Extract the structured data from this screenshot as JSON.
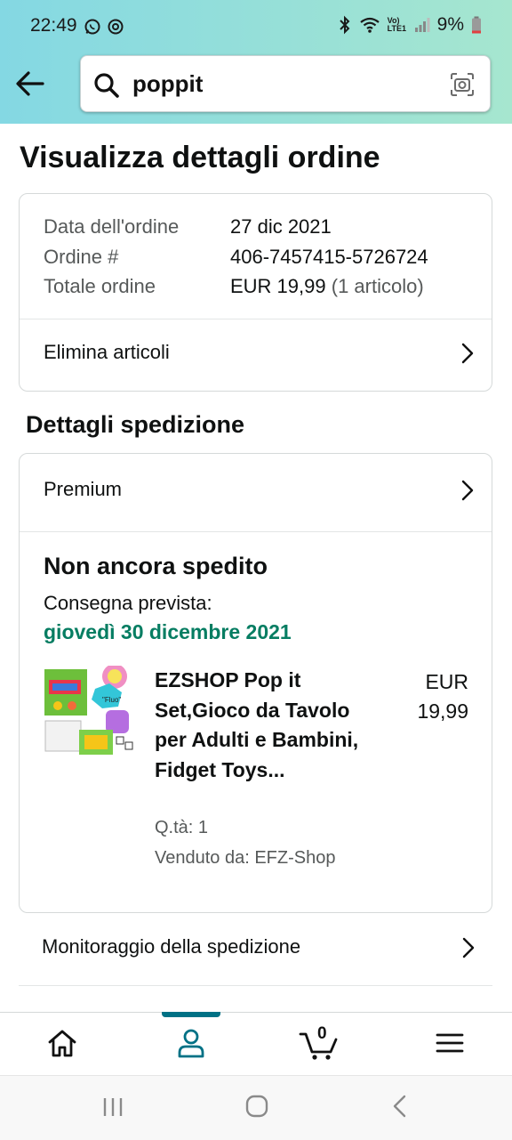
{
  "status_bar": {
    "time": "22:49",
    "battery": "9%",
    "network": "Vo) LTE1"
  },
  "search": {
    "query": "poppit"
  },
  "page_title": "Visualizza dettagli ordine",
  "order_summary": {
    "date_label": "Data dell'ordine",
    "date_value": "27 dic 2021",
    "number_label": "Ordine #",
    "number_value": "406-7457415-5726724",
    "total_label": "Totale ordine",
    "total_value": "EUR 19,99",
    "total_items": "(1 articolo)",
    "remove_items_label": "Elimina articoli"
  },
  "shipping_section_title": "Dettagli spedizione",
  "shipment": {
    "method": "Premium",
    "status": "Non ancora spedito",
    "delivery_label": "Consegna prevista:",
    "delivery_date": "giovedì 30 dicembre 2021",
    "item": {
      "title": "EZSHOP Pop it Set,Gioco da Tavolo per Adulti e Bambini, Fidget Toys...",
      "price_currency": "EUR",
      "price_amount": "19,99",
      "quantity": "Q.tà: 1",
      "seller": "Venduto da: EFZ-Shop"
    }
  },
  "tracking_label": "Monitoraggio della spedizione",
  "bottom_nav": {
    "cart_count": "0",
    "active_tab": "account"
  },
  "colors": {
    "header_gradient_start": "#84d8e3",
    "header_gradient_end": "#a6e6cf",
    "delivery_green": "#067d62",
    "nav_accent": "#007185"
  }
}
